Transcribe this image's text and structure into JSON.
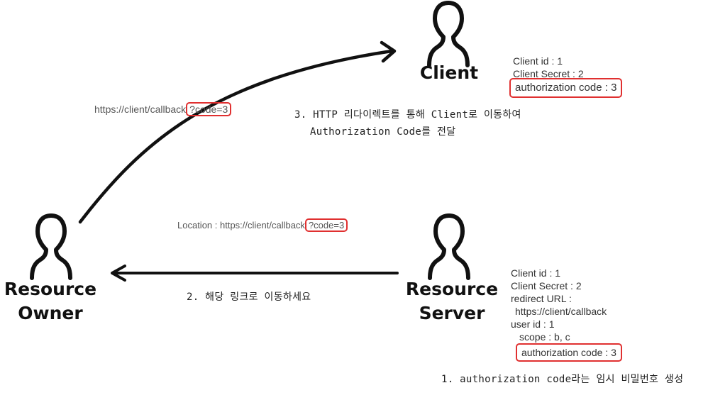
{
  "actors": {
    "client": {
      "label": "Client"
    },
    "resource_owner": {
      "label_line1": "Resource",
      "label_line2": "Owner"
    },
    "resource_server": {
      "label_line1": "Resource",
      "label_line2": "Server"
    }
  },
  "client_info": {
    "client_id": "Client id : 1",
    "client_secret": "Client Secret : 2",
    "authorization_code": "authorization code : 3"
  },
  "server_info": {
    "client_id": "Client id : 1",
    "client_secret": "Client Secret : 2",
    "redirect_url_label": "redirect URL :",
    "redirect_url_value": "https://client/callback",
    "user_id": "user id : 1",
    "scope": "scope : b, c",
    "authorization_code": "authorization code : 3"
  },
  "urls": {
    "callback_prefix": "https://client/callback",
    "callback_code": "?code=3",
    "location_prefix": "Location : https://client/callback",
    "location_code": "?code=3"
  },
  "steps": {
    "step1": "1. authorization code라는 임시 비밀번호 생성",
    "step2": "2. 해당 링크로 이동하세요",
    "step3_line1": "3. HTTP 리다이렉트를 통해 Client로 이동하여",
    "step3_line2": "Authorization Code를 전달"
  },
  "colors": {
    "highlight": "#e03030",
    "stroke": "#111111"
  },
  "icons": [
    "person-icon"
  ]
}
